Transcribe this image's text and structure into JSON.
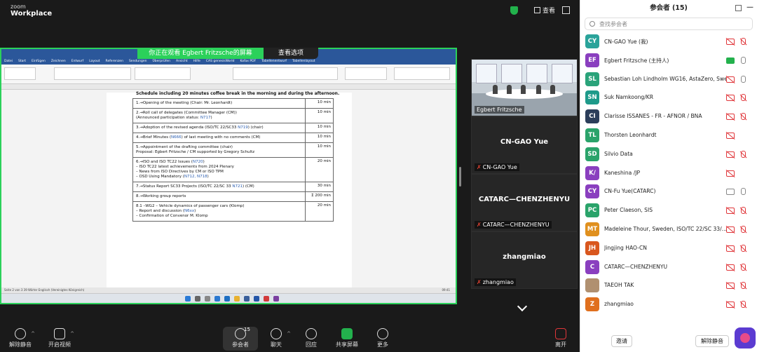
{
  "app": {
    "logo_line1": "zoom",
    "logo_line2": "Workplace",
    "view_label": "查看"
  },
  "share": {
    "banner": "你正在观看 Egbert Fritzsche的屏幕",
    "view_options": "查看选项",
    "word_tabs": [
      "Datei",
      "Start",
      "Einfügen",
      "Zeichnen",
      "Entwurf",
      "Layout",
      "Referenzen",
      "Sendungen",
      "Überprüfen",
      "Ansicht",
      "Hilfe",
      "CAS genesisWorld",
      "Kofax PDF",
      "Tabellenentwurf",
      "Tabellenlayout"
    ],
    "schedule_heading": "Schedule including 20 minutes coffee break in the morning and during the afternoon.",
    "rows": [
      {
        "lines": [
          {
            "t": "1.→Opening of the meeting (Chair: Mr. Leonhardt)"
          }
        ],
        "dur": "10 min"
      },
      {
        "lines": [
          {
            "t": "2.→Roll call of delegates (Committee Manager (CM))"
          },
          {
            "t": "(Announced participation status: ",
            "ref": "N717",
            "end": ")"
          }
        ],
        "dur": "10 min"
      },
      {
        "lines": [
          {
            "t": "3.→Adoption of the revised agenda (ISO/TC 22/SC33 ",
            "ref": "N719",
            "end": ") (chair)"
          }
        ],
        "dur": "10 min"
      },
      {
        "lines": [
          {
            "t": "4.→Brief Minutes (",
            "ref": "N666",
            "end": ") of last meeting with no comments (CM)"
          }
        ],
        "dur": "10 min"
      },
      {
        "lines": [
          {
            "t": "5.→Appointment of the drafting committee (chair)"
          },
          {
            "t": "Proposal: Egbert Fritzsche / CM supported by Gregory Schultz"
          }
        ],
        "dur": "10 min"
      },
      {
        "lines": [
          {
            "t": "6.→ISO and ISO TC22 Issues (",
            "ref": "N720",
            "end": ")"
          },
          {
            "t": "   –  ISO TC22 latest achievements from 2024 Plenary"
          },
          {
            "t": "   –  News from ISO Directives by CM or ISO TPM"
          },
          {
            "t": "   –  OSD Using Mandatory (",
            "ref": "N712, N718",
            "end": ")"
          }
        ],
        "dur": "20 min"
      },
      {
        "lines": [
          {
            "t": "7.→Status Report SC33 Projects (ISO/TC 22/SC 33 ",
            "ref": "N721",
            "end": ") (CM)"
          }
        ],
        "dur": "30 min"
      },
      {
        "lines": [
          {
            "t": "8.→Working group reports"
          }
        ],
        "dur": "Σ 200 min"
      },
      {
        "lines": [
          {
            "t": "   8.1 –WG2 – Vehicle dynamics of passenger cars (Klomp)"
          },
          {
            "t": "      –  Report and discussion (",
            "ref": "N6xx",
            "end": ")"
          },
          {
            "t": "      –  Confirmation of Convenor M. Klomp"
          }
        ],
        "dur": "20 min"
      }
    ],
    "status_left": "Seite 2 von 3   39 Wörter   Englisch (Vereinigtes Königreich)",
    "time": "09:41"
  },
  "videos": [
    {
      "name": "",
      "label": "Egbert Fritzsche",
      "muted": false,
      "type": "room"
    },
    {
      "name": "CN-GAO Yue",
      "label": "CN-GAO Yue",
      "muted": true,
      "type": "name"
    },
    {
      "name": "CATARC—CHENZHENYU",
      "label": "CATARC—CHENZHENYU",
      "muted": true,
      "type": "name"
    },
    {
      "name": "zhangmiao",
      "label": "zhangmiao",
      "muted": true,
      "type": "name"
    }
  ],
  "toolbar": {
    "mute": "解除静音",
    "video": "开启视频",
    "participants": "参会者",
    "participants_count": "15",
    "chat": "聊天",
    "react": "回应",
    "share": "共享屏幕",
    "more": "更多",
    "leave": "离开"
  },
  "panel": {
    "title": "参会者 (15)",
    "search_placeholder": "查找参会者",
    "participants": [
      {
        "initials": "CY",
        "color": "#2aa39a",
        "name": "CN-GAO Yue (我)",
        "mic": "muted",
        "cam": "off"
      },
      {
        "initials": "EF",
        "color": "#8a3fbf",
        "name": "Egbert Fritzsche (主持人)",
        "mic": "on",
        "cam": "on"
      },
      {
        "initials": "SL",
        "color": "#2aa37a",
        "name": "Sebastian Loh Lindholm WG16, AstaZero, Swe...",
        "mic": "on",
        "cam": "off"
      },
      {
        "initials": "SN",
        "color": "#1e9a8a",
        "name": "Suk Namkoong/KR",
        "mic": "muted",
        "cam": "off"
      },
      {
        "initials": "CI",
        "color": "#2c3e5a",
        "name": "Clarisse ISSANES - FR - AFNOR / BNA",
        "mic": "muted",
        "cam": "off"
      },
      {
        "initials": "TL",
        "color": "#2aa36a",
        "name": "Thorsten Leonhardt",
        "mic": "none",
        "cam": "off"
      },
      {
        "initials": "SD",
        "color": "#2aa36a",
        "name": "Silvio Data",
        "mic": "muted",
        "cam": "off"
      },
      {
        "initials": "K/",
        "color": "#8a3fbf",
        "name": "Kaneshina /JP",
        "mic": "none",
        "cam": "off"
      },
      {
        "initials": "CY",
        "color": "#8a3fbf",
        "name": "CN-Fu Yue(CATARC)",
        "mic": "on",
        "cam": "plain"
      },
      {
        "initials": "PC",
        "color": "#2aa36a",
        "name": "Peter Claeson, SIS",
        "mic": "muted",
        "cam": "off"
      },
      {
        "initials": "MT",
        "color": "#e0901e",
        "name": "Madeleine Thour, Sweden, ISO/TC 22/SC 33/...",
        "mic": "muted",
        "cam": "off"
      },
      {
        "initials": "JH",
        "color": "#d9571e",
        "name": "Jingjing HAO-CN",
        "mic": "muted",
        "cam": "off"
      },
      {
        "initials": "C",
        "color": "#8a3fbf",
        "name": "CATARC—CHENZHENYU",
        "mic": "muted",
        "cam": "off"
      },
      {
        "initials": "",
        "color": "#b09070",
        "name": "TAEOH TAK",
        "mic": "muted",
        "cam": "off"
      },
      {
        "initials": "Z",
        "color": "#e0701e",
        "name": "zhangmiao",
        "mic": "muted",
        "cam": "off"
      }
    ],
    "invite": "邀请",
    "mute_all": "解除静音"
  }
}
